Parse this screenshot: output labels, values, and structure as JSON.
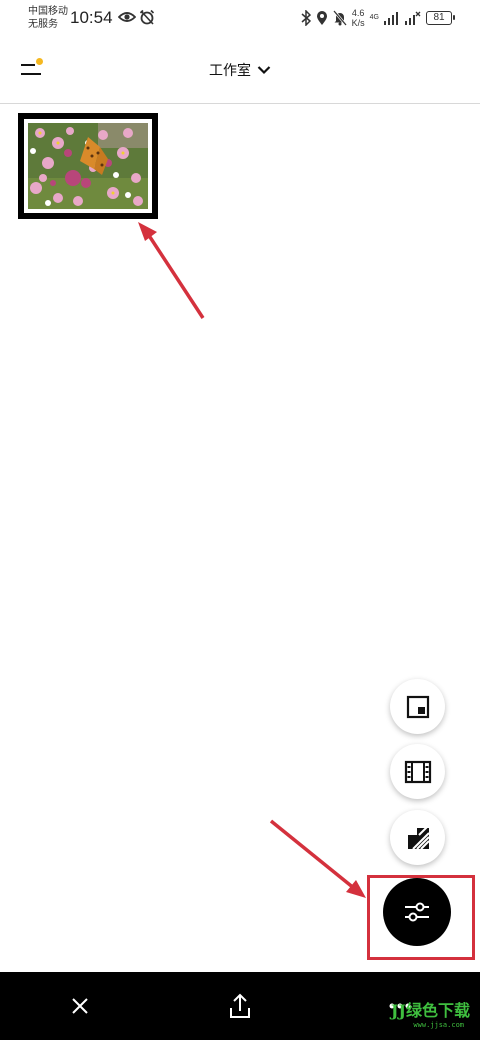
{
  "status_bar": {
    "carrier_line1": "中国移动",
    "carrier_line2": "无服务",
    "time": "10:54",
    "speed_value": "4.6",
    "speed_unit": "K/s",
    "network_type": "4G",
    "battery": "81"
  },
  "header": {
    "title": "工作室"
  },
  "colors": {
    "notification_dot": "#f5b820",
    "annotation_red": "#d4313d",
    "watermark_green": "#3fbf3f"
  },
  "fab_menu": {
    "items": [
      "layout-icon",
      "film-icon",
      "texture-icon"
    ],
    "main": "sliders-icon"
  },
  "bottom_bar": {
    "items": [
      "close-icon",
      "share-icon",
      "more-icon"
    ]
  },
  "watermark": {
    "text": "JJ绿色下载",
    "sub": "www.jjsa.com"
  }
}
